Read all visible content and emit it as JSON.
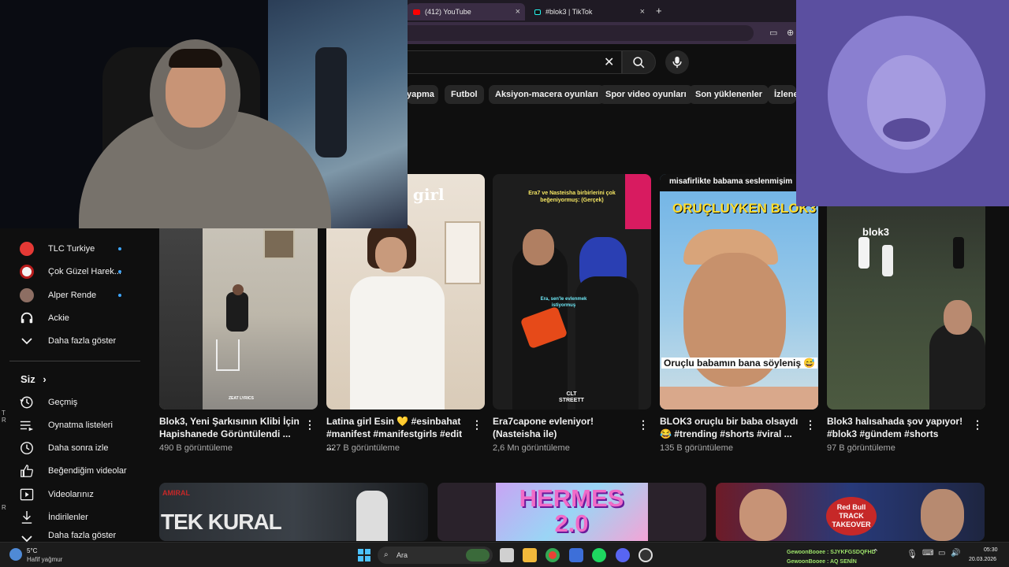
{
  "browser": {
    "tabs": [
      {
        "label": "(412) YouTube"
      },
      {
        "label": "#blok3 | TikTok"
      }
    ],
    "new_tab": "+",
    "close": "×"
  },
  "search": {
    "clear": "✕"
  },
  "chips": [
    "yapma",
    "Futbol",
    "Aksiyon-macera oyunları",
    "Spor video oyunları",
    "Son yüklenenler",
    "İzlene"
  ],
  "sidebar": {
    "subs": [
      {
        "label": "TLC Turkiye"
      },
      {
        "label": "Çok Güzel Harek..."
      },
      {
        "label": "Alper Rende"
      },
      {
        "label": "Ackie"
      }
    ],
    "show_more": "Daha fazla göster",
    "you_label": "Siz",
    "you_items": [
      {
        "label": "Geçmiş"
      },
      {
        "label": "Oynatma listeleri"
      },
      {
        "label": "Daha sonra izle"
      },
      {
        "label": "Beğendiğim videolar"
      },
      {
        "label": "Videolarınız"
      },
      {
        "label": "İndirilenler"
      },
      {
        "label": "Daha fazla göster"
      }
    ]
  },
  "shorts": [
    {
      "title": "Blok3, Yeni Şarkısının Klibi İçin Hapishanede Görüntülendi ...",
      "views": "490 B görüntüleme",
      "overlay": "ZEAT LYRICS"
    },
    {
      "title": "Latina girl Esin 💛 #esinbahat #manifest #manifestgirls #edit ...",
      "views": "227 B görüntüleme",
      "overlay": "a girl"
    },
    {
      "title": "Era7capone evleniyor! (Nasteisha ile)",
      "views": "2,6 Mn görüntüleme",
      "overlay": "Era7 ve Nasteisha birbirlerini çok beğeniyormuş: (Gerçek)",
      "overlay2": "Era, sen'le evlenmek istiyormuş",
      "overlay3": "CLT STREETT"
    },
    {
      "title": "BLOK3 oruçlu bir baba olsaydı 😂 #trending #shorts #viral ...",
      "views": "135 B görüntüleme",
      "overlay": "misafirlikte babama seslenmişim",
      "overlay2": "ORUÇLUYKEN BLOK3 😂",
      "overlay3": "Oruçlu babamın bana söyleniş 😅"
    },
    {
      "title": "Blok3 halısahada şov yapıyor! #blok3 #gündem #shorts",
      "views": "97 B görüntüleme",
      "overlay": "blok3"
    }
  ],
  "bottom_row": [
    {
      "overlay": "AMIRAL",
      "overlay2": "TEK KURAL"
    },
    {
      "overlay": "HERMES 2.0"
    },
    {
      "overlay": "Red Bull TRACK TAKEOVER"
    }
  ],
  "taskbar": {
    "weather_temp": "5°C",
    "weather_desc": "Hafif yağmur",
    "search_label": "Ara",
    "chat1": "GewoonBooee : SJYKFGSDQFHD",
    "chat2": "GewoonBooee : AQ SENİN",
    "time": "05:30",
    "date": "20.03.2026"
  }
}
